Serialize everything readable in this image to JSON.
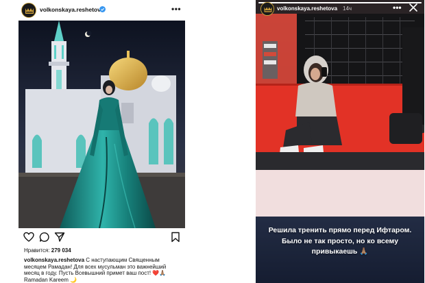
{
  "post": {
    "username": "volkonskaya.reshetova",
    "more_label": "•••",
    "likes_label": "Нравится:",
    "likes_count": "279 034",
    "caption_user": "volkonskaya.reshetova",
    "caption_text": "С наступающим Священным месяцем Рамадан! Для всех мусульман это важнейший месяц в году. Пусть Всевышний примет ваш пост! ❤️🙏🏽 Ramadan Kareem 🌙",
    "icons": [
      "heart-icon",
      "comment-icon",
      "share-icon",
      "bookmark-icon",
      "verified-icon"
    ]
  },
  "story": {
    "username": "volkonskaya.reshetova",
    "time": "14ч",
    "more_label": "•••",
    "text": "Решила тренить прямо перед Ифтаром. Было не так просто, но ко всему привыкаешь 🙏🏽",
    "progress": 1.0,
    "icons": [
      "close-icon"
    ]
  },
  "colors": {
    "verified": "#3897f0",
    "dress": "#1f8c86",
    "floor": "#e23226"
  }
}
